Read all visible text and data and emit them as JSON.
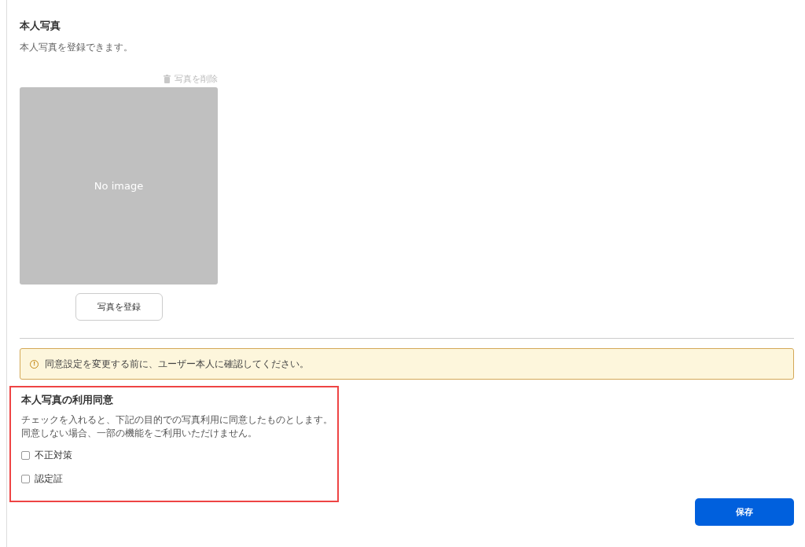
{
  "photo_section": {
    "title": "本人写真",
    "description": "本人写真を登録できます。",
    "delete_link": "写真を削除",
    "image": {
      "text": "No image"
    },
    "register_button": "写真を登録"
  },
  "alert": {
    "icon": "!",
    "message": "同意設定を変更する前に、ユーザー本人に確認してください。"
  },
  "consent_section": {
    "highlighted": true,
    "title": "本人写真の利用同意",
    "description_lines": [
      "チェックを入れると、下記の目的での写真利用に同意したものとします。",
      "同意しない場合、一部の機能をご利用いただけません。"
    ],
    "options": [
      {
        "label": "不正対策",
        "checked": false
      },
      {
        "label": "認定証",
        "checked": false
      }
    ]
  },
  "save_button": "保存"
}
